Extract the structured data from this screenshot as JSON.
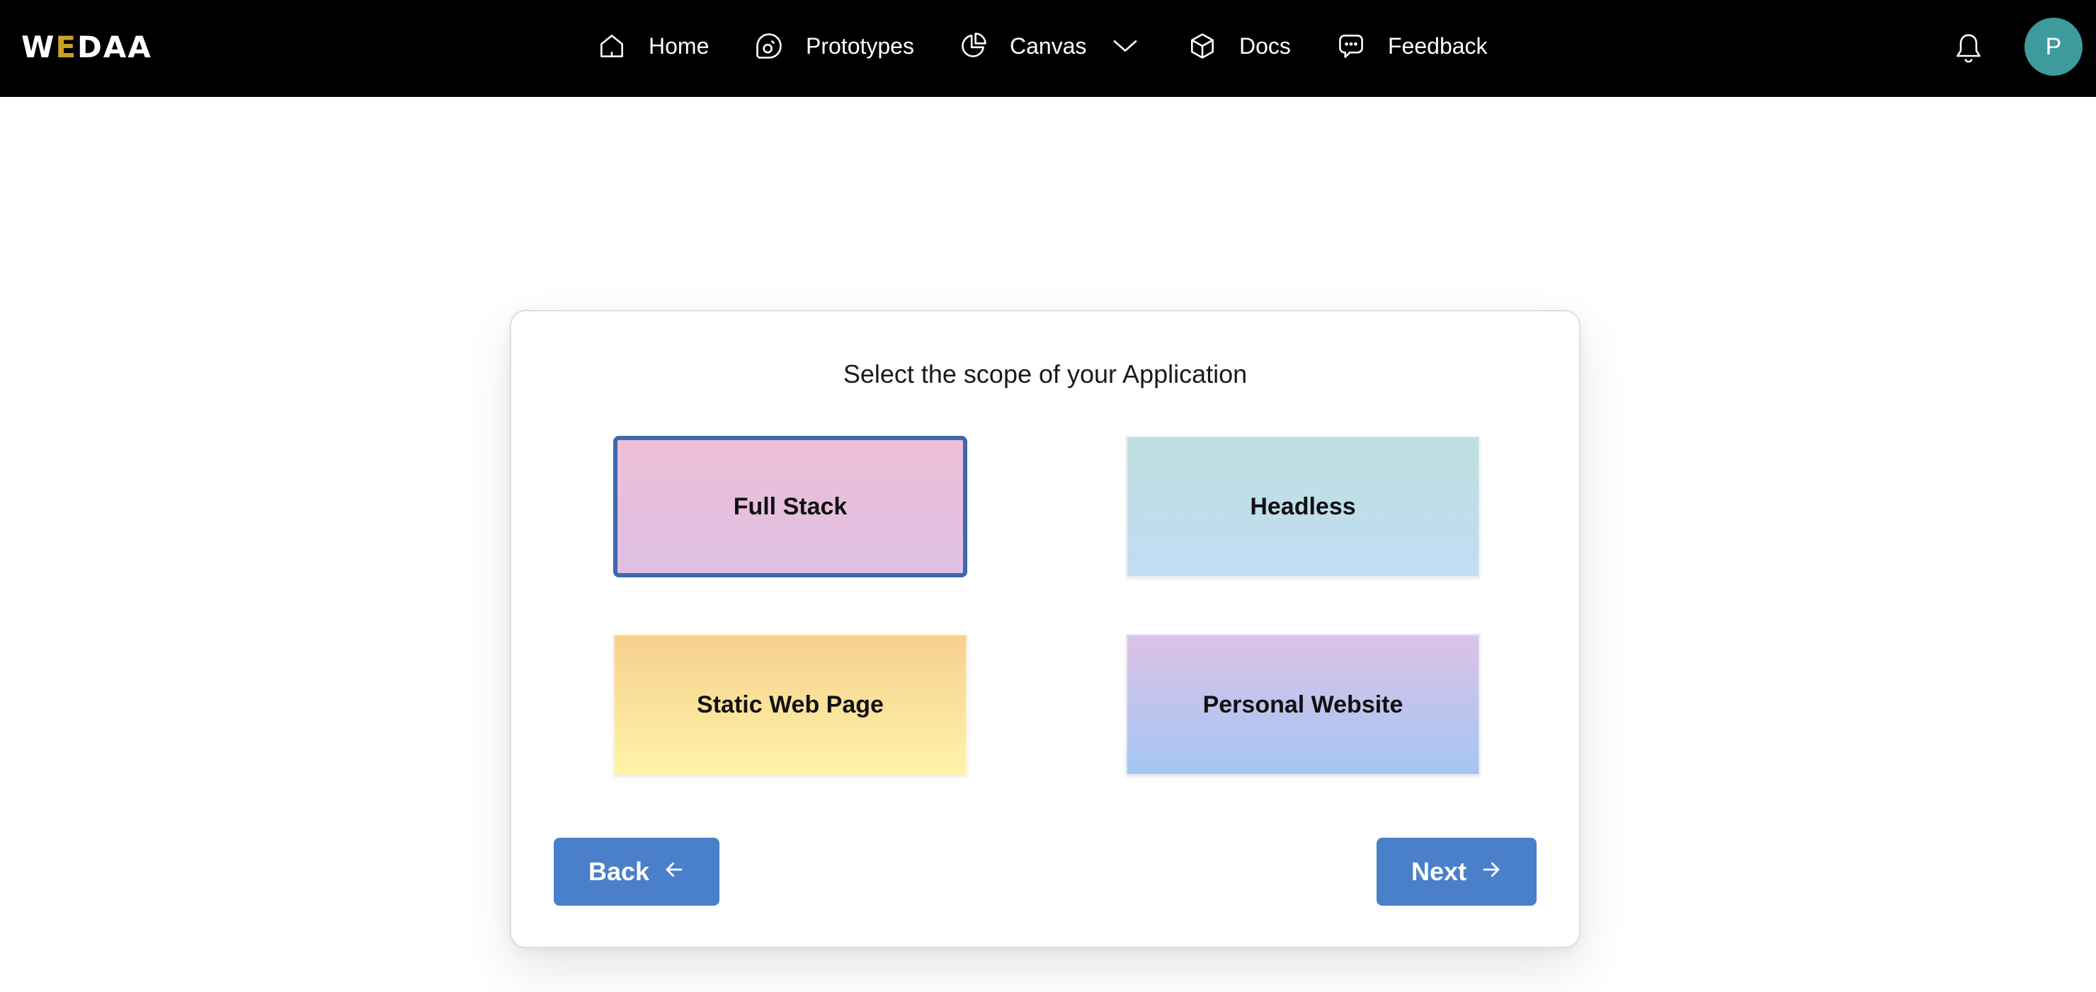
{
  "brand": {
    "logo_prefix": "W",
    "logo_accent": "E",
    "logo_suffix": "DAA",
    "accent_color": "#c9a227"
  },
  "nav": {
    "items": [
      {
        "label": "Home",
        "icon": "home-icon"
      },
      {
        "label": "Prototypes",
        "icon": "prototypes-icon"
      },
      {
        "label": "Canvas",
        "icon": "canvas-icon",
        "has_dropdown": true
      },
      {
        "label": "Docs",
        "icon": "cube-icon"
      },
      {
        "label": "Feedback",
        "icon": "chat-bubble-icon"
      }
    ],
    "notifications_icon": "bell-icon",
    "avatar_initial": "P",
    "avatar_color": "#3d9a9d"
  },
  "dialog": {
    "title": "Select the scope of your Application",
    "options": [
      {
        "label": "Full Stack",
        "selected": true
      },
      {
        "label": "Headless",
        "selected": false
      },
      {
        "label": "Static Web Page",
        "selected": false
      },
      {
        "label": "Personal Website",
        "selected": false
      }
    ],
    "back_label": "Back",
    "next_label": "Next",
    "button_color": "#4a80c9",
    "selected_border_color": "#3f67ad"
  }
}
